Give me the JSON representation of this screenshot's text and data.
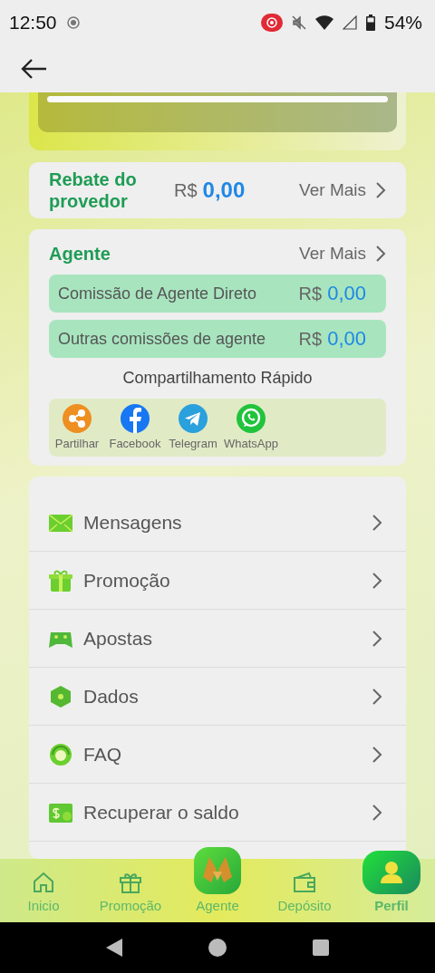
{
  "status_bar": {
    "time": "12:50",
    "battery": "54%"
  },
  "rebate": {
    "title": "Rebate do provedor",
    "currency": "R$",
    "amount": "0,00",
    "link": "Ver Mais"
  },
  "agent": {
    "title": "Agente",
    "link": "Ver Mais",
    "rows": [
      {
        "label": "Comissão de Agente Direto",
        "currency": "R$",
        "amount": "0,00"
      },
      {
        "label": "Outras comissões de agente",
        "currency": "R$",
        "amount": "0,00"
      }
    ],
    "share_title": "Compartilhamento Rápido",
    "share": [
      {
        "kind": "share",
        "label": "Partilhar"
      },
      {
        "kind": "facebook",
        "label": "Facebook"
      },
      {
        "kind": "telegram",
        "label": "Telegram"
      },
      {
        "kind": "whatsapp",
        "label": "WhatsApp"
      }
    ]
  },
  "menu": [
    {
      "kind": "mail",
      "label": "Mensagens"
    },
    {
      "kind": "gift",
      "label": "Promoção"
    },
    {
      "kind": "gamepad",
      "label": "Apostas"
    },
    {
      "kind": "hexagon",
      "label": "Dados"
    },
    {
      "kind": "support",
      "label": "FAQ"
    },
    {
      "kind": "money",
      "label": "Recuperar o saldo"
    }
  ],
  "bottom_nav": [
    {
      "kind": "home",
      "label": "Inicio",
      "selected": false
    },
    {
      "kind": "gift",
      "label": "Promoção",
      "selected": false
    },
    {
      "kind": "agent",
      "label": "Agente",
      "selected": false
    },
    {
      "kind": "wallet",
      "label": "Depósito",
      "selected": false
    },
    {
      "kind": "profile",
      "label": "Perfil",
      "selected": true
    }
  ]
}
